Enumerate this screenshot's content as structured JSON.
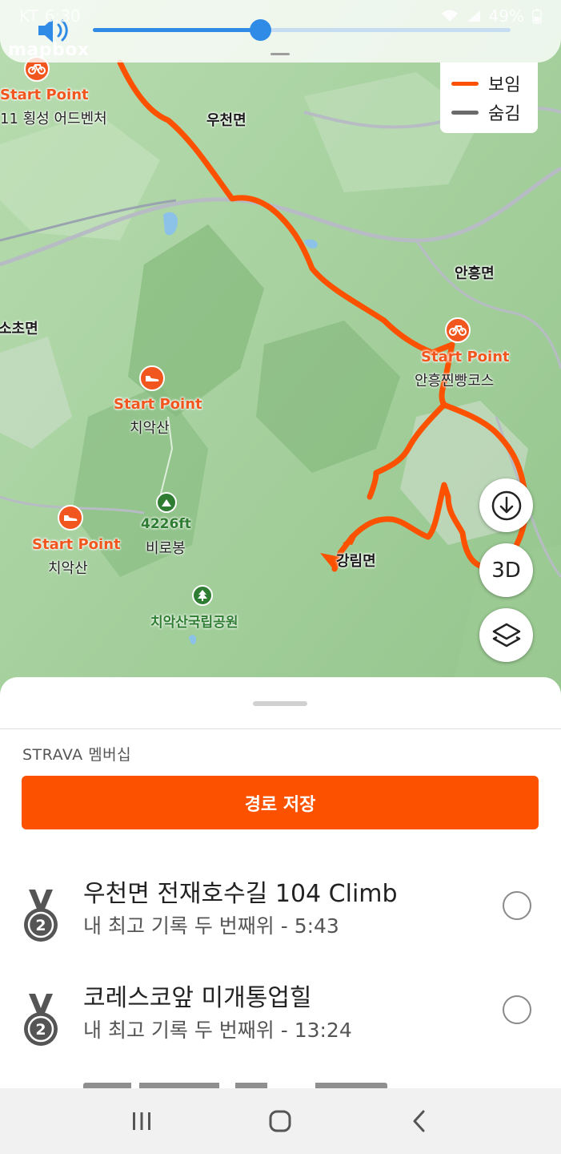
{
  "status_bar": {
    "carrier": "KT",
    "time": "6:30",
    "battery": "49%"
  },
  "volume": {
    "level_fraction": 0.4
  },
  "map": {
    "attribution": "mapbox",
    "legend": {
      "shown_label": "보임",
      "hidden_label": "숨김",
      "shown_color": "#fc5200",
      "hidden_color": "#6b6b6b"
    },
    "places": [
      {
        "text": "우천면"
      },
      {
        "text": "안흥면"
      },
      {
        "text": "소초면"
      },
      {
        "text": "강림면"
      }
    ],
    "start_points": [
      {
        "label": "Start Point",
        "name": "11 횡성 어드벤처",
        "icon": "bike-icon"
      },
      {
        "label": "Start Point",
        "name": "안흥찐빵코스",
        "icon": "bike-icon"
      },
      {
        "label": "Start Point",
        "name": "치악산",
        "icon": "shoe-icon"
      },
      {
        "label": "Start Point",
        "name": "치악산",
        "icon": "shoe-icon"
      }
    ],
    "peak": {
      "elevation": "4226ft",
      "name": "비로봉"
    },
    "park": {
      "name": "치악산국립공원"
    },
    "controls": {
      "download_icon": "download-icon",
      "three_d_label": "3D",
      "layers_icon": "layers-icon"
    }
  },
  "sheet": {
    "membership_label": "STRAVA 멤버십",
    "save_button_label": "경로 저장",
    "segments": [
      {
        "title": "우천면 전재호수길 104 Climb",
        "subtitle": "내 최고 기록 두 번째위 - 5:43",
        "medal": "2"
      },
      {
        "title": "코레스코앞 미개통업힐",
        "subtitle": "내 최고 기록 두 번째위 - 13:24",
        "medal": "2"
      }
    ]
  },
  "nav": {
    "recents_icon": "recents-icon",
    "home_icon": "home-icon",
    "back_icon": "back-icon"
  }
}
